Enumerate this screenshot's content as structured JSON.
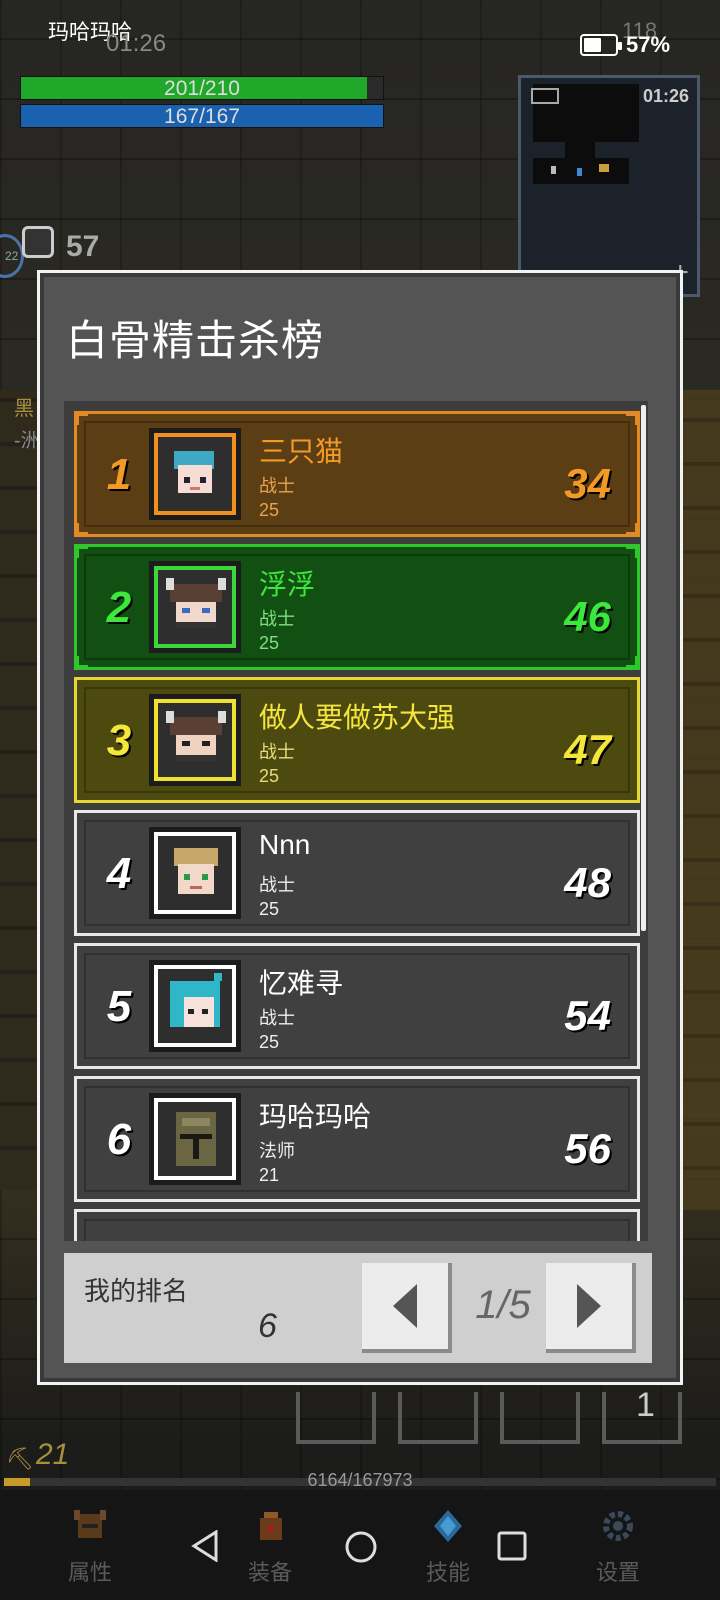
{
  "status_bar": {
    "player_name": "玛哈玛哈",
    "time": "01:26",
    "fps": "118",
    "battery": "57%",
    "battery_level": 0.57
  },
  "hud": {
    "hp": "201/210",
    "hp_fraction": 0.957,
    "mp": "167/167",
    "mp_fraction": 1.0,
    "minimap_time": "01:26",
    "level_badge": "22",
    "timer_value": "57",
    "side_text_a": "黑",
    "side_text_b": "-洲"
  },
  "leaderboard": {
    "title": "白骨精击杀榜",
    "entries": [
      {
        "rank": "1",
        "name": "三只猫",
        "class": "战士",
        "level": "25",
        "score": "34",
        "tier": "gold"
      },
      {
        "rank": "2",
        "name": "浮浮",
        "class": "战士",
        "level": "25",
        "score": "46",
        "tier": "green"
      },
      {
        "rank": "3",
        "name": "做人要做苏大强",
        "class": "战士",
        "level": "25",
        "score": "47",
        "tier": "yellow"
      },
      {
        "rank": "4",
        "name": "Nnn",
        "class": "战士",
        "level": "25",
        "score": "48",
        "tier": "plain"
      },
      {
        "rank": "5",
        "name": "忆难寻",
        "class": "战士",
        "level": "25",
        "score": "54",
        "tier": "plain"
      },
      {
        "rank": "6",
        "name": "玛哈玛哈",
        "class": "法师",
        "level": "21",
        "score": "56",
        "tier": "plain"
      }
    ],
    "my_rank_label": "我的排名",
    "my_rank_value": "6",
    "page": "1/5"
  },
  "bottom": {
    "slot_count": "1",
    "player_level": "21",
    "xp_text": "6164/167973",
    "xp_fraction": 0.037,
    "nav": [
      {
        "label": "属性",
        "icon": "helmet-icon"
      },
      {
        "label": "装备",
        "icon": "bag-icon"
      },
      {
        "label": "技能",
        "icon": "crystal-icon"
      },
      {
        "label": "设置",
        "icon": "gear-icon"
      }
    ]
  },
  "colors": {
    "gold": "#f39a26",
    "green": "#3de83d",
    "yellow": "#f4e63a",
    "hp": "#1fa82a",
    "mp": "#1a62b0"
  }
}
